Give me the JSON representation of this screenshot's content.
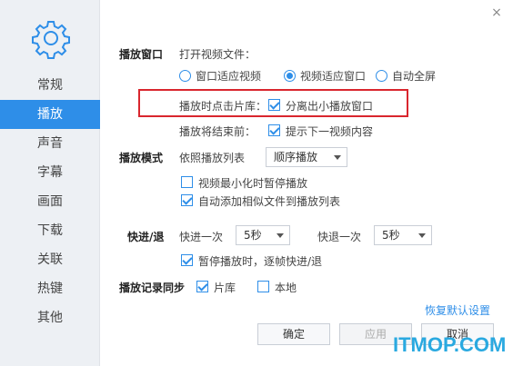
{
  "sidebar": {
    "items": [
      {
        "label": "常规"
      },
      {
        "label": "播放"
      },
      {
        "label": "声音"
      },
      {
        "label": "字幕"
      },
      {
        "label": "画面"
      },
      {
        "label": "下载"
      },
      {
        "label": "关联"
      },
      {
        "label": "热键"
      },
      {
        "label": "其他"
      }
    ],
    "active": "播放"
  },
  "close": "×",
  "playback_window": {
    "title": "播放窗口",
    "open_file_label": "打开视频文件：",
    "options": [
      {
        "label": "窗口适应视频",
        "selected": false
      },
      {
        "label": "视频适应窗口",
        "selected": true
      },
      {
        "label": "自动全屏",
        "selected": false
      }
    ],
    "click_library_label": "播放时点击片库：",
    "click_library_option": {
      "label": "分离出小播放窗口",
      "checked": true
    },
    "end_label": "播放将结束前：",
    "end_option": {
      "label": "提示下一视频内容",
      "checked": true
    }
  },
  "play_mode": {
    "title": "播放模式",
    "order_label": "依照播放列表",
    "order_value": "顺序播放",
    "pause_minimized": {
      "label": "视频最小化时暂停播放",
      "checked": false
    },
    "auto_add": {
      "label": "自动添加相似文件到播放列表",
      "checked": true
    }
  },
  "seek": {
    "title": "快进/退",
    "forward_label": "快进一次",
    "forward_value": "5秒",
    "backward_label": "快退一次",
    "backward_value": "5秒",
    "frame_step": {
      "label": "暂停播放时，逐帧快进/退",
      "checked": true
    }
  },
  "history_sync": {
    "title": "播放记录同步",
    "library": {
      "label": "片库",
      "checked": true
    },
    "local": {
      "label": "本地",
      "checked": false
    }
  },
  "restore_defaults": "恢复默认设置",
  "buttons": {
    "ok": "确定",
    "apply": "应用",
    "cancel": "取消"
  },
  "watermark": "ITMOP.COM",
  "colors": {
    "accent": "#2e8ee8",
    "highlight_border": "#d9262e",
    "sidebar_bg": "#edf0f4"
  }
}
